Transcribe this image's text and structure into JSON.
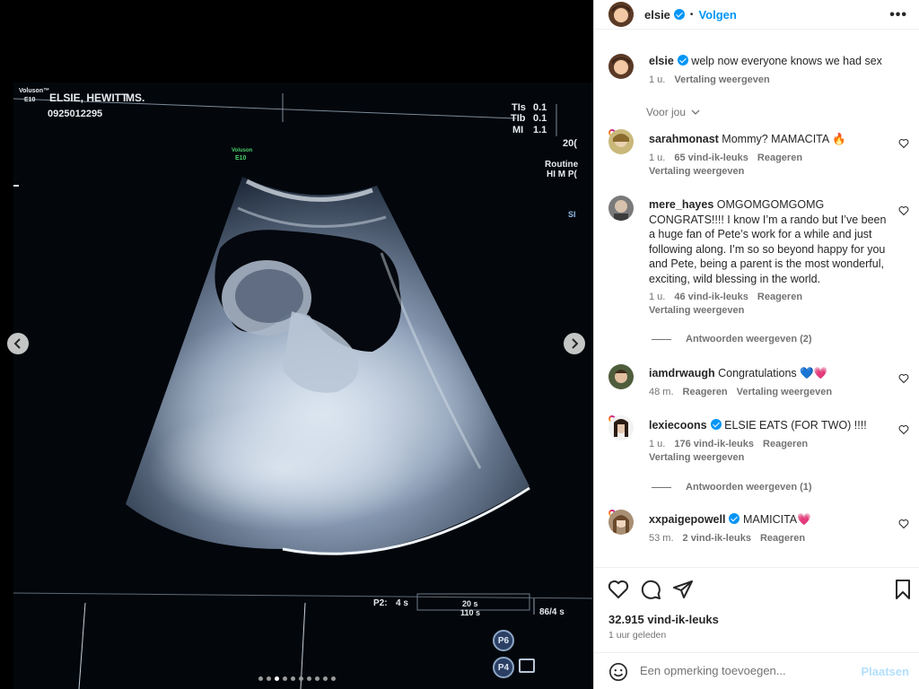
{
  "scan": {
    "patient": "ELSIE, HEWITT",
    "ms": "MS.",
    "id": "0925012295",
    "brand": "Voluson™",
    "model": "E10",
    "tis": "TIs",
    "tis_val": "0.1",
    "tib": "TIb",
    "tib_val": "0.1",
    "mi": "MI",
    "mi_val": "1.1",
    "year_partial": "20(",
    "routine": "Routine",
    "himp": "HI M P(",
    "si": "SI",
    "green1": "Voluson",
    "green2": "E10",
    "p2": "P2:",
    "p2_val": "4 s",
    "t1": "20 s",
    "t2": "110 s",
    "frame": "86/4 s",
    "btn_p6": "P6",
    "btn_p4": "P4"
  },
  "carousel": {
    "slides": 10,
    "active_index": 2
  },
  "header": {
    "username": "elsie",
    "separator": "•",
    "follow": "Volgen",
    "more": "•••"
  },
  "caption": {
    "username": "elsie",
    "text": "welp now everyone knows we had sex",
    "time": "1 u.",
    "translate": "Vertaling weergeven"
  },
  "sort": {
    "label": "Voor jou"
  },
  "comments": [
    {
      "username": "sarahmonast",
      "text": "Mommy? MAMACITA 🔥",
      "time": "1 u.",
      "likes": "65 vind-ik-leuks",
      "reply": "Reageren",
      "translate": "Vertaling weergeven"
    },
    {
      "username": "mere_hayes",
      "text": "OMGOMGOMGOMG CONGRATS!!!! I know I’m a rando but I’ve been a huge fan of Pete’s work for a while and just following along. I’m so so beyond happy for you and Pete, being a parent is the most wonderful, exciting, wild blessing in the world.",
      "time": "1 u.",
      "likes": "46 vind-ik-leuks",
      "reply": "Reageren",
      "translate": "Vertaling weergeven",
      "replies": "Antwoorden weergeven (2)"
    },
    {
      "username": "iamdrwaugh",
      "text": "Congratulations 💙💗",
      "time": "48 m.",
      "reply": "Reageren",
      "translate": "Vertaling weergeven"
    },
    {
      "username": "lexiecoons",
      "text": "ELSIE EATS (FOR TWO) !!!!",
      "time": "1 u.",
      "likes": "176 vind-ik-leuks",
      "reply": "Reageren",
      "translate": "Vertaling weergeven",
      "replies": "Antwoorden weergeven (1)"
    },
    {
      "username": "xxpaigepowell",
      "text": "MAMICITA💗",
      "time": "53 m.",
      "likes": "2 vind-ik-leuks",
      "reply": "Reageren"
    }
  ],
  "footer": {
    "likes": "32.915 vind-ik-leuks",
    "time_ago": "1 uur geleden",
    "comment_placeholder": "Een opmerking toevoegen...",
    "post": "Plaatsen"
  },
  "colors": {
    "accent": "#0095f6",
    "post_disabled": "#b2dffc",
    "heart_emoji": "#f0346c"
  }
}
